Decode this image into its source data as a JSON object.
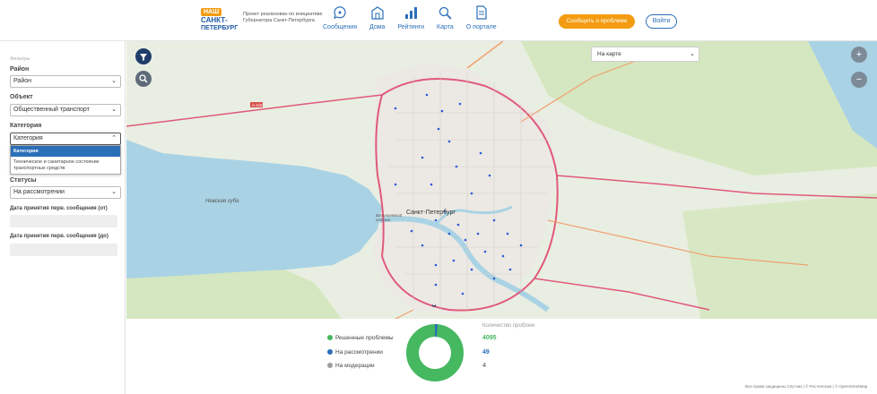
{
  "header": {
    "logo_top": "НАШ",
    "logo_mid": "САНКТ-",
    "logo_bottom": "ПЕТЕРБУРГ",
    "tagline": "Проект реализован по инициативе Губернатора Санкт-Петербурга",
    "nav": [
      {
        "label": "Сообщения",
        "icon": "messages-icon"
      },
      {
        "label": "Дома",
        "icon": "houses-icon"
      },
      {
        "label": "Рейтинги",
        "icon": "ratings-icon"
      },
      {
        "label": "Карта",
        "icon": "map-search-icon"
      },
      {
        "label": "О портале",
        "icon": "document-icon"
      }
    ],
    "report_button": "Сообщить о проблеме",
    "login_button": "Войти"
  },
  "sidebar": {
    "title": "Фильтры",
    "district_label": "Район",
    "district_value": "Район",
    "object_label": "Объект",
    "object_value": "Общественный транспорт",
    "category_label": "Категория",
    "category_value": "Категория",
    "category_options": [
      "Категория",
      "Техническое и санитарное состояние транспортных средств"
    ],
    "status_label": "Статусы",
    "status_value": "На рассмотрении",
    "date_from_label": "Дата принятия перв. сообщения (от)",
    "date_to_label": "Дата принятия перв. сообщения (до)"
  },
  "map": {
    "view_select": "На карте",
    "zoom_in": "+",
    "zoom_out": "−",
    "labels": {
      "gulf": "Невская губа",
      "city": "Санкт-Петербург",
      "island": "Васильевский остров"
    },
    "road_shield": "A-118",
    "colors": {
      "water": "#a9d3e4",
      "land": "#e9eee2",
      "city": "#ece9e4",
      "forest": "#cfe2b8",
      "ring": "#e0597a",
      "marker": "#2a5bd7"
    }
  },
  "stats": {
    "count_title": "Количество проблем",
    "items": [
      {
        "label": "Решенные проблемы",
        "value": "4095",
        "color": "#45b860"
      },
      {
        "label": "На рассмотрении",
        "value": "49",
        "color": "#2a6fb8"
      },
      {
        "label": "На модерации",
        "value": "4",
        "color": "#9e9e9e"
      }
    ],
    "copyright": "Все права защищены Спутник | © Ростелеком | © OpenStreetMap"
  }
}
